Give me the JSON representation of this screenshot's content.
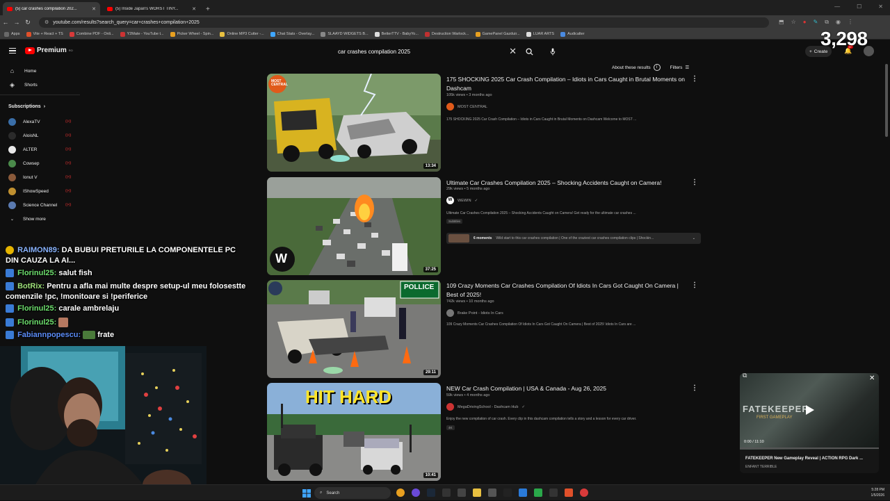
{
  "browser": {
    "tabs": [
      {
        "label": "(5) car crashes compilation 202...",
        "active": true
      },
      {
        "label": "(5) Inside Japan's WORST TINY...",
        "active": false
      }
    ],
    "url": "youtube.com/results?search_query=car+crashes+compilation+2025",
    "bookmarks": [
      "Apps",
      "Vite + React + TS",
      "Combine PDF - Onli...",
      "Y2Mate - YouTube t...",
      "Picker Wheel - Spin...",
      "Online MP3 Cutter -...",
      "Chat Stats - Overlay...",
      "SLAAYD WIDGETS B...",
      "BetterTTV - BabyYo...",
      "Destruction Warlock...",
      "GamePanel Gazduir...",
      "LUAR ARTS",
      "Audicalter"
    ]
  },
  "stream_overlay": {
    "view_count": "3,298"
  },
  "header": {
    "logo_text": "Premium",
    "logo_superscript": "RO",
    "search_value": "car crashes compilation 2025",
    "create_label": "Create",
    "notification_count": "9+"
  },
  "sidebar": {
    "items": [
      {
        "label": "Home",
        "icon": "home-icon"
      },
      {
        "label": "Shorts",
        "icon": "shorts-icon"
      }
    ],
    "subscriptions_label": "Subscriptions",
    "subscriptions": [
      {
        "name": "AlexaTV",
        "color": "#3a6ea8"
      },
      {
        "name": "AloisNL",
        "color": "#2b2b2b"
      },
      {
        "name": "ALTER",
        "color": "#e8e8e8"
      },
      {
        "name": "Cowsep",
        "color": "#4a8a4a"
      },
      {
        "name": "Ionut V",
        "color": "#8a5a3a"
      },
      {
        "name": "IShowSpeed",
        "color": "#c09030"
      },
      {
        "name": "Science Channel",
        "color": "#5a7ab0"
      }
    ],
    "show_more_label": "Show more"
  },
  "chat": {
    "messages": [
      {
        "name": "RAIMON89:",
        "text": " DA BUBUI PRETURILE LA COMPONENTELE PC",
        "cont": "DIN CAUZA LA AI..."
      },
      {
        "name": "Florinul25:",
        "text": " salut fish"
      },
      {
        "name": "BotRix:",
        "text": " Pentru a afla mai multe despre setup-ul meu folosestte",
        "cont": "comenzile !pc, !monitoare si !periferice"
      },
      {
        "name": "Florinul25:",
        "text": " carale ambrelaju"
      },
      {
        "name": "Florinul25:",
        "text": ""
      },
      {
        "name": "Fabiannpopescu:",
        "text": " frate"
      }
    ]
  },
  "results": {
    "about_label": "About these results",
    "filters_label": "Filters",
    "videos": [
      {
        "title": "175 SHOCKING 2025 Car Crash Compilation – Idiots in Cars Caught in Brutal Moments on Dashcam",
        "meta": "105k views • 3 months ago",
        "channel": "MOST CENTRAL",
        "channel_color": "#e05a1a",
        "description": "175 SHOCKING 2025 Car Crash Compilation – Idiots in Cars Caught in Brutal Moments on Dashcam Welcome to MOST ...",
        "duration": "13:34",
        "thumb_text": "MOST CENTRAL"
      },
      {
        "title": "Ultimate Car Crashes Compilation 2025 – Shocking Accidents Caught on Camera!",
        "meta": "29k views • 5 months ago",
        "channel": "WEWIN",
        "channel_color": "#ffffff",
        "description": "Ultimate Car Crashes Compilation 2025 – Shocking Accidents Caught on Camera! Get ready for the ultimate car crashes ...",
        "chip": "Subtitles",
        "moments_label": "6 moments",
        "moments_text": "Wild start to this car crashes compilation | One of the craziest car crashes compilation clips | Shockin...",
        "duration": "37:25",
        "thumb_text": "W"
      },
      {
        "title": "109 Crazy Moments Car Crashes Compilation Of Idiots In Cars Got Caught On Camera | Best of 2025!",
        "meta": "742k views • 10 months ago",
        "channel": "Brake Point - Idiots In Cars",
        "channel_color": "#777777",
        "description": "109 Crazy Moments Car Crashes Compilation Of Idiots In Cars Got Caught On Camera | Best of 2025! Idiots In Cars are ...",
        "duration": "29:11",
        "thumb_text": "POLLICE"
      },
      {
        "title": "NEW Car Crash Compilation | USA & Canada - Aug 26, 2025",
        "meta": "59k views • 4 months ago",
        "channel": "MegaDrivingSchool - Dashcam Hub",
        "channel_color": "#cc3333",
        "description": "Enjoy the new compilation of car crash. Every clip in this dashcam compilation tells a story and a lesson for every car driver.",
        "chip": "4K",
        "duration": "10:41",
        "thumb_text": "HIT HARD"
      }
    ]
  },
  "miniplayer": {
    "overlay_title": "FATEKEEPER",
    "overlay_sub": "FIRST GAMEPLAY",
    "time": "0:00 / 11:10",
    "title": "FATEKEEPER New Gameplay Reveal | ACTION RPG Dark ...",
    "channel": "ENFANT TERRIBLE"
  },
  "taskbar": {
    "search_label": "Search",
    "time": "5:28 PM",
    "date": "1/5/2026"
  }
}
